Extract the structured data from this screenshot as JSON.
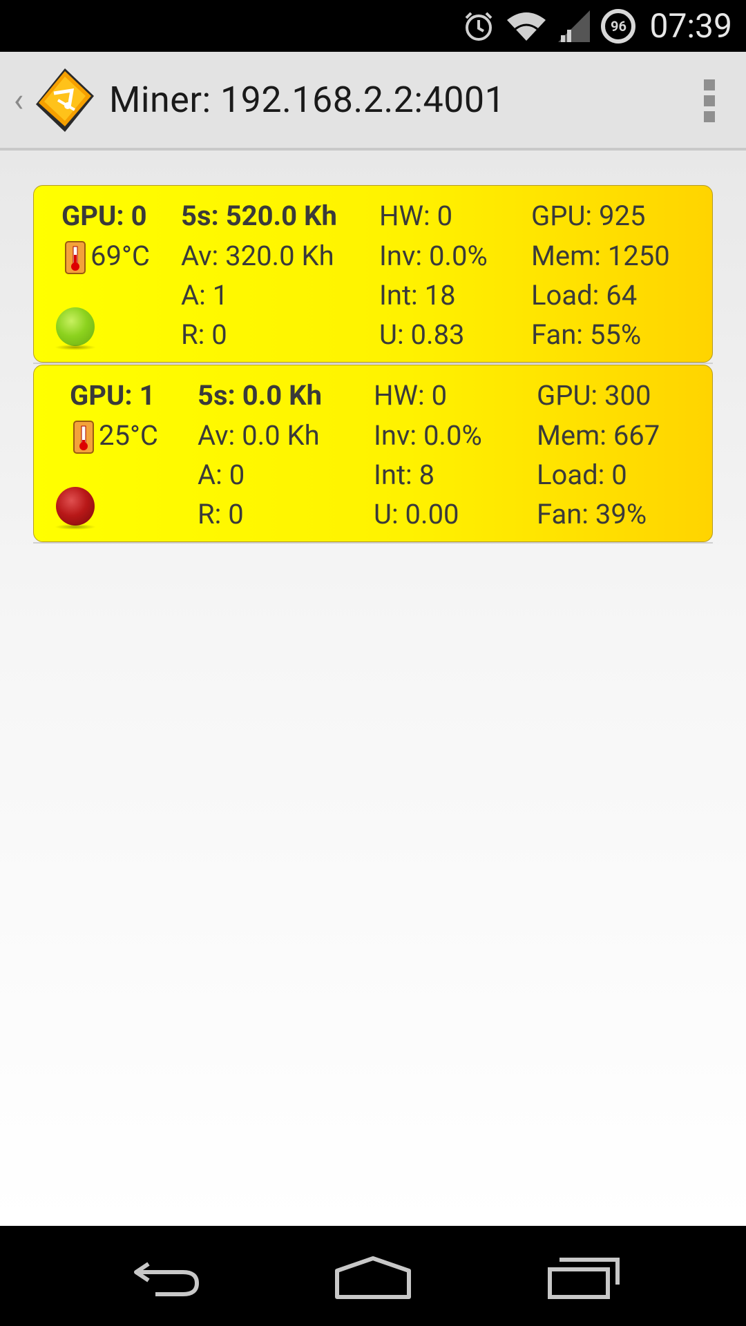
{
  "status_bar": {
    "time": "07:39",
    "battery_level": "96",
    "icons": [
      "alarm-icon",
      "wifi-icon",
      "signal-icon",
      "battery-icon"
    ]
  },
  "action_bar": {
    "title": "Miner: 192.168.2.2:4001",
    "icons": [
      "back-caret-icon",
      "app-logo-icon",
      "overflow-menu-icon"
    ]
  },
  "gpus": [
    {
      "name": "GPU: 0",
      "temperature": "69°C",
      "status": "ok",
      "status_color": "#8cd21e",
      "rate_5s": "5s: 520.0 Kh",
      "avg": "Av: 320.0 Kh",
      "accepted": "A: 1",
      "rejected": "R: 0",
      "hw": "HW: 0",
      "inv": "Inv: 0.0%",
      "intensity": "Int: 18",
      "utility": "U: 0.83",
      "gpu_clock": "GPU: 925",
      "mem_clock": "Mem: 1250",
      "load": "Load: 64",
      "fan": "Fan: 55%"
    },
    {
      "name": "GPU: 1",
      "temperature": "25°C",
      "status": "bad",
      "status_color": "#b81818",
      "rate_5s": "5s: 0.0 Kh",
      "avg": "Av: 0.0 Kh",
      "accepted": "A: 0",
      "rejected": "R: 0",
      "hw": "HW: 0",
      "inv": "Inv: 0.0%",
      "intensity": "Int: 8",
      "utility": "U: 0.00",
      "gpu_clock": "GPU: 300",
      "mem_clock": "Mem: 667",
      "load": "Load: 0",
      "fan": "Fan: 39%"
    }
  ],
  "nav_bar": {
    "icons": [
      "back-icon",
      "home-icon",
      "recent-apps-icon"
    ]
  },
  "colors": {
    "card_yellow": "#ffff00",
    "card_orange": "#ffd400",
    "action_bar_bg": "#e3e3e3"
  }
}
